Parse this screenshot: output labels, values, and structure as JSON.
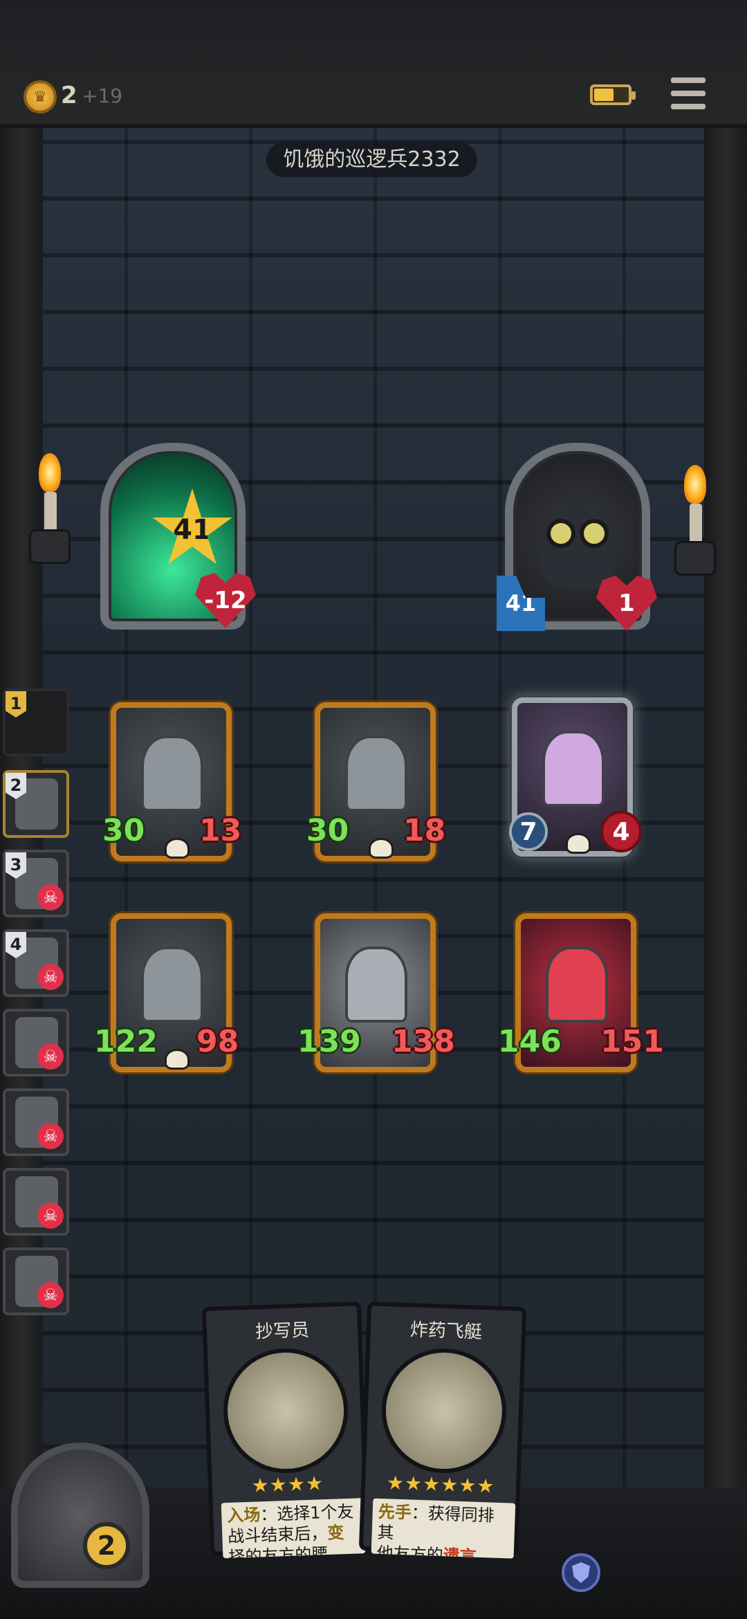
{
  "header": {
    "gold": "2",
    "gold_income": "+19"
  },
  "opponent": {
    "name": "饥饿的巡逻兵2332"
  },
  "heroes": {
    "enemy": {
      "attack": "41",
      "health": "-12"
    },
    "player": {
      "attack": "41",
      "health": "1"
    }
  },
  "board": {
    "units": [
      {
        "attack": "30",
        "health": "13"
      },
      {
        "attack": "30",
        "health": "18"
      },
      {
        "attack": "7",
        "health": "4"
      },
      {
        "attack": "122",
        "health": "98"
      },
      {
        "attack": "139",
        "health": "138"
      },
      {
        "attack": "146",
        "health": "151"
      }
    ]
  },
  "turn_order": {
    "items": [
      {
        "num": "1"
      },
      {
        "num": "2"
      },
      {
        "num": "3"
      },
      {
        "num": "4"
      }
    ]
  },
  "hand": {
    "cards": [
      {
        "title": "抄写员",
        "stars": "★★★★",
        "keyword": "入场",
        "text_a": "：选择1个友",
        "text_b": "战斗结束后，",
        "text_c": "变",
        "text_d": "择的友方的腰"
      },
      {
        "title": "炸药飞艇",
        "stars": "★★★★★★",
        "keyword": "先手",
        "text_a": "：获得同排其",
        "text_b": "他友方的",
        "text_c": "遗言"
      }
    ]
  },
  "shop": {
    "level": "2"
  },
  "icons": {
    "coin": "crown-coin-icon",
    "battery": "battery-icon",
    "menu": "hamburger-menu-icon",
    "shield": "shield-icon",
    "dead": "skull-x-icon"
  }
}
